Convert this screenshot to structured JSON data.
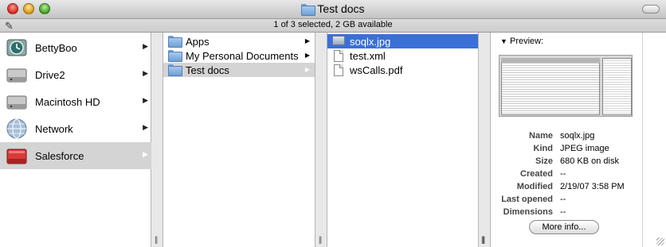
{
  "window": {
    "title": "Test docs",
    "status": "1 of 3 selected, 2 GB available"
  },
  "sidebar": {
    "items": [
      {
        "label": "BettyBoo",
        "icon": "time-machine-icon"
      },
      {
        "label": "Drive2",
        "icon": "hard-drive-icon"
      },
      {
        "label": "Macintosh HD",
        "icon": "hard-drive-icon"
      },
      {
        "label": "Network",
        "icon": "network-globe-icon"
      },
      {
        "label": "Salesforce",
        "icon": "red-drive-icon",
        "selected": true
      }
    ]
  },
  "columns": {
    "folders": [
      {
        "label": "Apps"
      },
      {
        "label": "My Personal Documents"
      },
      {
        "label": "Test docs",
        "selected": true
      }
    ],
    "files": [
      {
        "label": "soqlx.jpg",
        "selected": true,
        "icon": "image-file-icon"
      },
      {
        "label": "test.xml",
        "icon": "document-icon"
      },
      {
        "label": "wsCalls.pdf",
        "icon": "document-icon"
      }
    ]
  },
  "preview": {
    "label": "Preview:",
    "info": [
      {
        "key": "Name",
        "value": "soqlx.jpg"
      },
      {
        "key": "Kind",
        "value": "JPEG image"
      },
      {
        "key": "Size",
        "value": "680 KB on disk"
      },
      {
        "key": "Created",
        "value": "--"
      },
      {
        "key": "Modified",
        "value": "2/19/07 3:58 PM"
      },
      {
        "key": "Last opened",
        "value": "--"
      },
      {
        "key": "Dimensions",
        "value": "--"
      }
    ],
    "more_button": "More info..."
  },
  "colors": {
    "selection_blue": "#3a6fd8",
    "selection_grey": "#d4d4d4"
  }
}
